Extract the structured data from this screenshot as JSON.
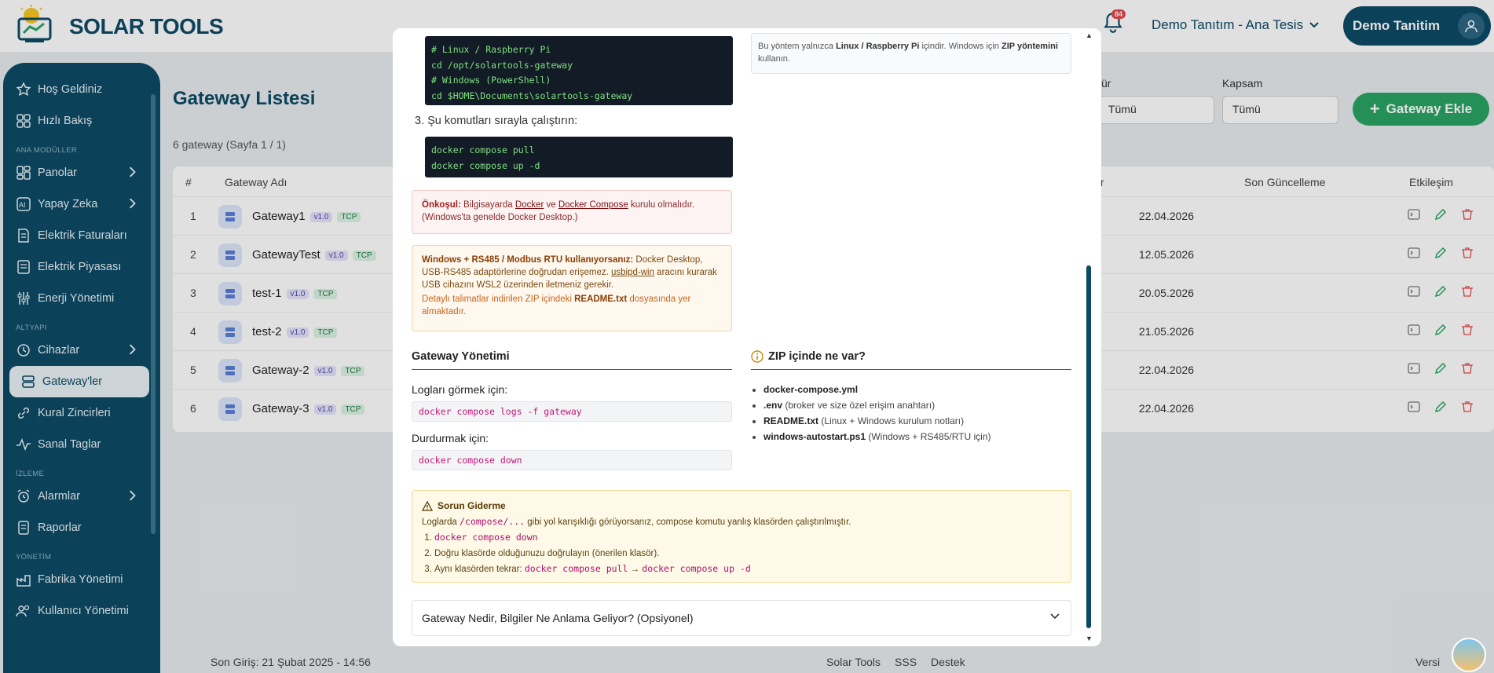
{
  "app": {
    "logo_text": "SOLAR TOOLS",
    "notification_count": "84",
    "plant_selector": "Demo Tanıtım - Ana Tesis",
    "user_name": "Demo Tanitim"
  },
  "sidebar": {
    "items_top": [
      {
        "label": "Hoş Geldiniz",
        "icon": "star-icon"
      },
      {
        "label": "Hızlı Bakış",
        "icon": "grid-icon"
      }
    ],
    "section_main": "ANA MODÜLLER",
    "items_main": [
      {
        "label": "Panolar",
        "icon": "dashboard-icon",
        "has_children": true
      },
      {
        "label": "Yapay Zeka",
        "icon": "ai-icon",
        "has_children": true
      },
      {
        "label": "Elektrik Faturaları",
        "icon": "invoice-icon"
      },
      {
        "label": "Elektrik Piyasası",
        "icon": "market-icon"
      },
      {
        "label": "Enerji Yönetimi",
        "icon": "sliders-icon"
      }
    ],
    "section_infra": "ALTYAPI",
    "items_infra": [
      {
        "label": "Cihazlar",
        "icon": "devices-icon",
        "has_children": true
      },
      {
        "label": "Gateway'ler",
        "icon": "server-icon",
        "active": true
      },
      {
        "label": "Kural Zincirleri",
        "icon": "chain-icon"
      },
      {
        "label": "Sanal Taglar",
        "icon": "pulse-icon"
      }
    ],
    "section_monitor": "İZLEME",
    "items_monitor": [
      {
        "label": "Alarmlar",
        "icon": "alarm-icon",
        "has_children": true
      },
      {
        "label": "Raporlar",
        "icon": "report-icon"
      }
    ],
    "section_manage": "YÖNETİM",
    "items_manage": [
      {
        "label": "Fabrika Yönetimi",
        "icon": "factory-icon"
      },
      {
        "label": "Kullanıcı Yönetimi",
        "icon": "users-icon"
      }
    ]
  },
  "page": {
    "title": "Gateway Listesi",
    "count_text": "6 gateway (Sayfa 1 / 1)",
    "filter1_label": "ür",
    "filter1_value": "Tümü",
    "filter2_label": "Kapsam",
    "filter2_value": "Tümü",
    "add_button": "Gateway Ekle"
  },
  "table": {
    "headers": {
      "num": "#",
      "name": "Gateway Adı",
      "col3": "lar",
      "updated": "Son Güncelleme",
      "actions": "Etkileşim"
    },
    "rows": [
      {
        "num": "1",
        "name": "Gateway1",
        "version": "v1.0",
        "proto": "TCP",
        "updated": "22.04.2026"
      },
      {
        "num": "2",
        "name": "GatewayTest",
        "version": "v1.0",
        "proto": "TCP",
        "updated": "12.05.2026"
      },
      {
        "num": "3",
        "name": "test-1",
        "version": "v1.0",
        "proto": "TCP",
        "updated": "20.05.2026"
      },
      {
        "num": "4",
        "name": "test-2",
        "version": "v1.0",
        "proto": "TCP",
        "updated": "21.05.2026"
      },
      {
        "num": "5",
        "name": "Gateway-2",
        "version": "v1.0",
        "proto": "TCP",
        "updated": "22.04.2026"
      },
      {
        "num": "6",
        "name": "Gateway-3",
        "version": "v1.0",
        "proto": "TCP",
        "updated": "22.04.2026"
      }
    ]
  },
  "footer": {
    "last_login": "Son Giriş: 21 Şubat 2025 - 14:56",
    "links": [
      "Solar Tools",
      "SSS",
      "Destek"
    ],
    "version": "Versi"
  },
  "modal": {
    "code_paths": [
      "# Linux / Raspberry Pi",
      "cd /opt/solartools-gateway",
      "# Windows (PowerShell)",
      "cd $HOME\\Documents\\solartools-gateway"
    ],
    "step3": "3. Şu komutları sırayla çalıştırın:",
    "code_compose": [
      "docker compose pull",
      "docker compose up -d"
    ],
    "note_right": {
      "p1": "Bu yöntem yalnızca ",
      "b1": "Linux / Raspberry Pi",
      "p2": " içindir. Windows için ",
      "b2": "ZIP yöntemini",
      "p3": " kullanın."
    },
    "prereq": {
      "label": "Önkoşul:",
      "t1": " Bilgisayarda ",
      "link1": "Docker",
      "t2": " ve ",
      "link2": "Docker Compose",
      "t3": " kurulu olmalıdır.",
      "t4": "(Windows'ta genelde Docker Desktop.)"
    },
    "win_rs485": {
      "label": "Windows + RS485 / Modbus RTU kullanıyorsanız:",
      "t1": " Docker Desktop, USB-RS485 adaptörlerine doğrudan erişemez. ",
      "link": "usbipd-win",
      "t2": " aracını kurarak USB cihazını WSL2 üzerinden iletmeniz gerekir.",
      "s1": "Detaylı talimatlar indirilen ZIP içindeki ",
      "sb": "README.txt",
      "s2": " dosyasında yer almaktadır."
    },
    "mgmt_title": "Gateway Yönetimi",
    "logs_label": "Logları görmek için:",
    "logs_cmd": "docker compose logs -f gateway",
    "stop_label": "Durdurmak için:",
    "stop_cmd": "docker compose down",
    "zip_title": "ZIP içinde ne var?",
    "zip_items": [
      {
        "name": "docker-compose.yml",
        "desc": ""
      },
      {
        "name": ".env",
        "desc": " (broker ve size özel erişim anahtarı)"
      },
      {
        "name": "README.txt",
        "desc": " (Linux + Windows kurulum notları)"
      },
      {
        "name": "windows-autostart.ps1",
        "desc": " (Windows + RS485/RTU için)"
      }
    ],
    "trouble": {
      "title": "Sorun Giderme",
      "t1": "Loglarda ",
      "code1": "/compose/...",
      "t2": " gibi yol karışıklığı görüyorsanız, compose komutu yanlış klasörden çalıştırılmıştır.",
      "step1": "docker compose down",
      "step2": "Doğru klasörde olduğunuzu doğrulayın (önerilen klasör).",
      "step3a": "Aynı klasörden tekrar: ",
      "step3b": "docker compose pull",
      "arrow": " → ",
      "step3c": "docker compose up -d"
    },
    "accordion": "Gateway Nedir, Bilgiler Ne Anlama Geliyor? (Opsiyonel)"
  },
  "colors": {
    "brand": "#0d4a66",
    "success": "#2aa464",
    "danger": "#e5484d",
    "code_bg": "#131b27",
    "code_text": "#7fe07f"
  }
}
